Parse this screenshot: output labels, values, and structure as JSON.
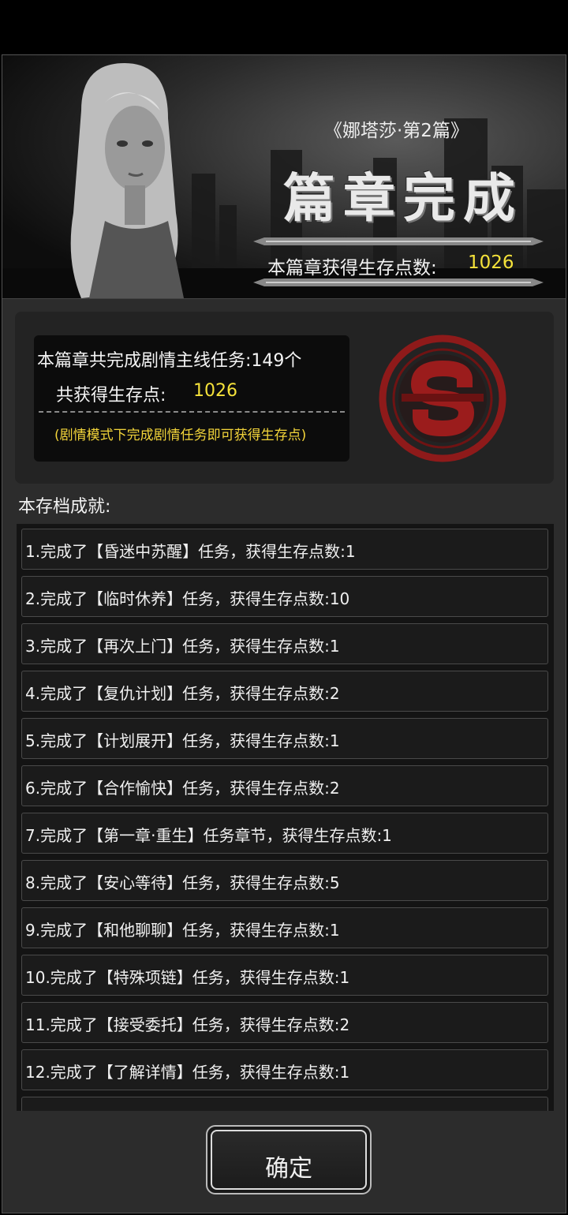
{
  "banner": {
    "subtitle": "《娜塔莎·第2篇》",
    "title": "篇章完成",
    "points_label": "本篇章获得生存点数:",
    "points_value": "1026"
  },
  "summary": {
    "tasks_line": "本篇章共完成剧情主线任务:149个",
    "total_label": "共获得生存点:",
    "total_value": "1026",
    "hint": "(剧情模式下完成剧情任务即可获得生存点)"
  },
  "achievements": {
    "title": "本存档成就:",
    "items": [
      "1.完成了【昏迷中苏醒】任务，获得生存点数:1",
      "2.完成了【临时休养】任务，获得生存点数:10",
      "3.完成了【再次上门】任务，获得生存点数:1",
      "4.完成了【复仇计划】任务，获得生存点数:2",
      "5.完成了【计划展开】任务，获得生存点数:1",
      "6.完成了【合作愉快】任务，获得生存点数:2",
      "7.完成了【第一章·重生】任务章节，获得生存点数:1",
      "8.完成了【安心等待】任务，获得生存点数:5",
      "9.完成了【和他聊聊】任务，获得生存点数:1",
      "10.完成了【特殊项链】任务，获得生存点数:1",
      "11.完成了【接受委托】任务，获得生存点数:2",
      "12.完成了【了解详情】任务，获得生存点数:1"
    ]
  },
  "confirm_label": "确定",
  "colors": {
    "highlight": "#f5e23a",
    "emblem": "#9b1c1c"
  },
  "icons": {
    "emblem": "survival-s-emblem-icon"
  }
}
